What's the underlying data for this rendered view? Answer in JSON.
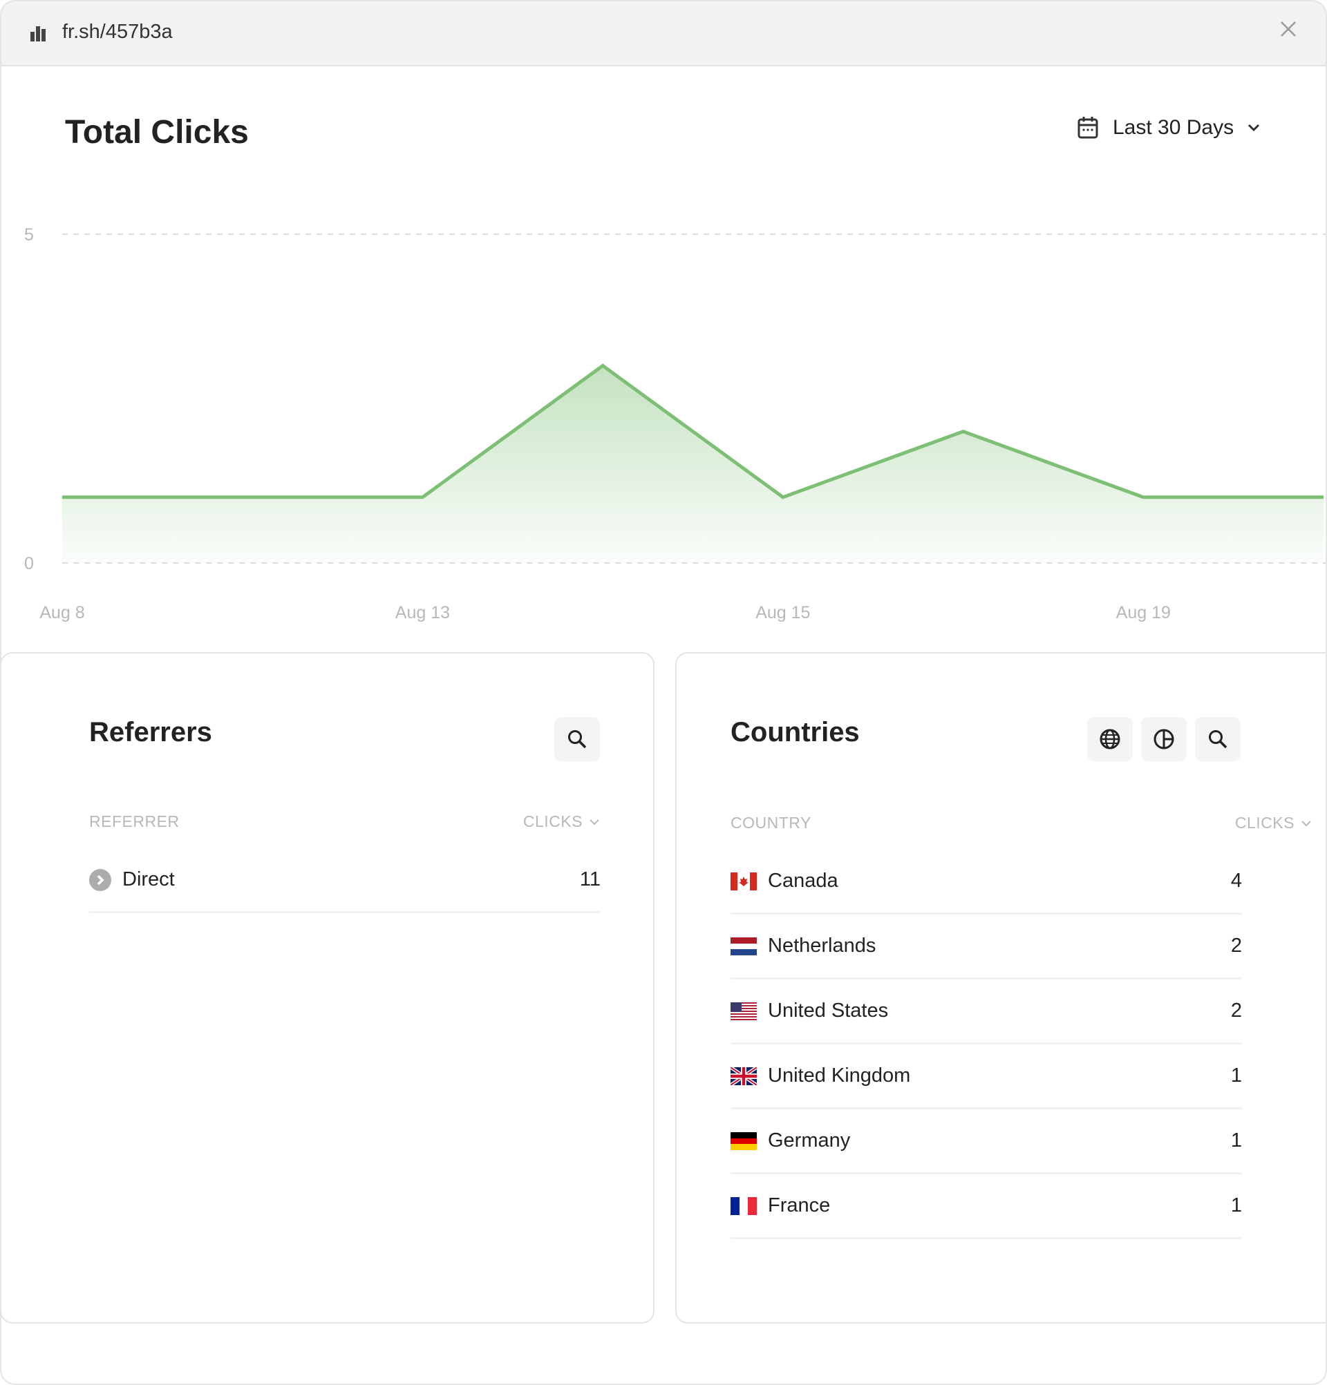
{
  "window": {
    "url": "fr.sh/457b3a",
    "logo_icon": "bar-chart-icon",
    "close_icon": "close-icon"
  },
  "header": {
    "title": "Total Clicks",
    "date_range": "Last 30 Days"
  },
  "chart_data": {
    "type": "area",
    "title": "",
    "xlabel": "",
    "ylabel": "",
    "categories": [
      "Aug 8",
      "",
      "Aug 13",
      "",
      "Aug 15",
      "",
      "Aug 19",
      ""
    ],
    "x_tick_labels": [
      "Aug 8",
      "Aug 13",
      "Aug 15",
      "Aug 19"
    ],
    "y_tick_labels": [
      "5",
      "0"
    ],
    "values": [
      1,
      1,
      1,
      3,
      1,
      2,
      1,
      1
    ],
    "ylim": [
      0,
      5
    ],
    "grid": "dashed horizontal",
    "color": "#7dbf74"
  },
  "referrers": {
    "title": "Referrers",
    "col_name": "REFERRER",
    "col_value": "CLICKS",
    "rows": [
      {
        "name": "Direct",
        "clicks": "11",
        "icon": "chevron-right-circle-icon"
      }
    ]
  },
  "countries": {
    "title": "Countries",
    "col_name": "COUNTRY",
    "col_value": "CLICKS",
    "rows": [
      {
        "name": "Canada",
        "clicks": "4",
        "flag": "ca"
      },
      {
        "name": "Netherlands",
        "clicks": "2",
        "flag": "nl"
      },
      {
        "name": "United States",
        "clicks": "2",
        "flag": "us"
      },
      {
        "name": "United Kingdom",
        "clicks": "1",
        "flag": "gb"
      },
      {
        "name": "Germany",
        "clicks": "1",
        "flag": "de"
      },
      {
        "name": "France",
        "clicks": "1",
        "flag": "fr"
      }
    ]
  }
}
